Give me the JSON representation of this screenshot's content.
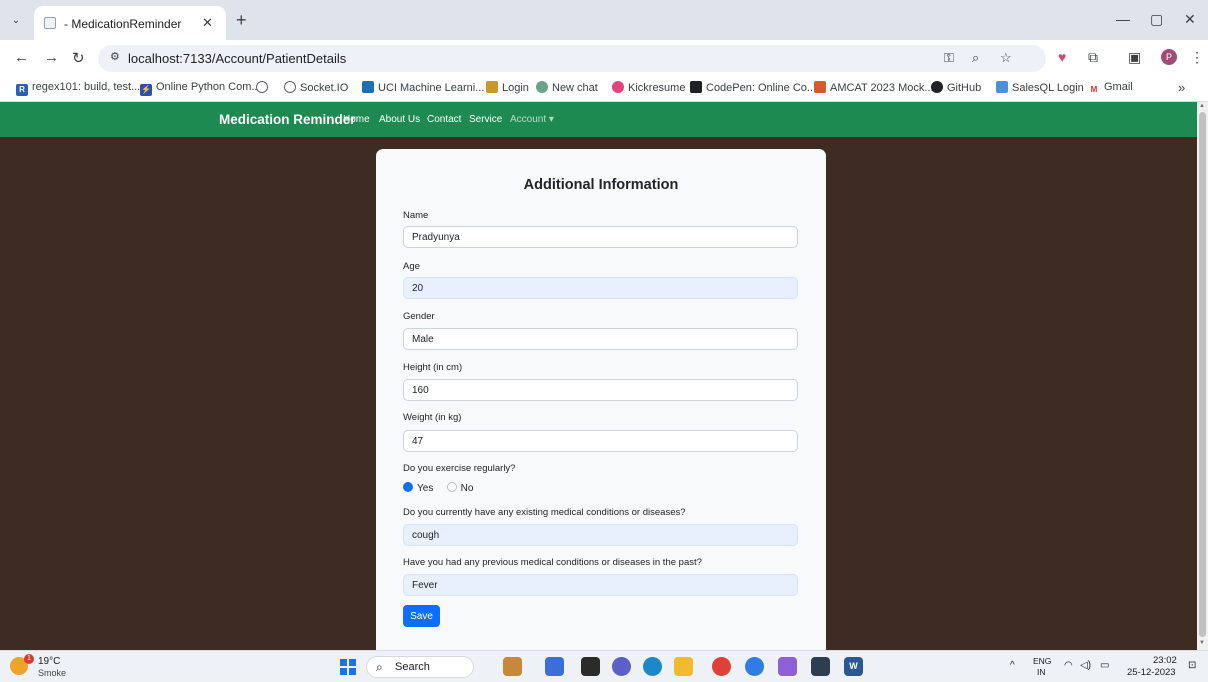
{
  "browser": {
    "tab": {
      "title": "- MedicationReminder"
    },
    "url": "localhost:7133/Account/PatientDetails",
    "bookmarks": [
      {
        "label": "regex101: build, test...",
        "icon": "regex101-icon",
        "color": "#2c5fb8",
        "glyph": "R"
      },
      {
        "label": "Online Python Com...",
        "icon": "python-compiler-icon",
        "color": "#2b4fb5",
        "glyph": "⚡"
      },
      {
        "label": "",
        "icon": "globe-icon",
        "color": "#5f6368",
        "glyph": ""
      },
      {
        "label": "Socket.IO",
        "icon": "socketio-icon",
        "color": "#5f6368",
        "glyph": ""
      },
      {
        "label": "UCI Machine Learni...",
        "icon": "uci-icon",
        "color": "#1f6fb2",
        "glyph": ""
      },
      {
        "label": "Login",
        "icon": "login-icon",
        "color": "#c89a2e",
        "glyph": ""
      },
      {
        "label": "New chat",
        "icon": "chatgpt-icon",
        "color": "#6aa38a",
        "glyph": ""
      },
      {
        "label": "Kickresume",
        "icon": "kickresume-icon",
        "color": "#e2447a",
        "glyph": ""
      },
      {
        "label": "CodePen: Online Co...",
        "icon": "codepen-icon",
        "color": "#202124",
        "glyph": ""
      },
      {
        "label": "AMCAT 2023 Mock...",
        "icon": "amcat-icon",
        "color": "#d45a2b",
        "glyph": ""
      },
      {
        "label": "GitHub",
        "icon": "github-icon",
        "color": "#202124",
        "glyph": ""
      },
      {
        "label": "SalesQL Login",
        "icon": "salesql-icon",
        "color": "#4a90d9",
        "glyph": ""
      },
      {
        "label": "Gmail",
        "icon": "gmail-icon",
        "color": "#d93025",
        "glyph": "M"
      }
    ],
    "profile_initial": "P"
  },
  "navbar": {
    "brand": "Medication Reminder",
    "links": [
      "Home",
      "About Us",
      "Contact",
      "Service"
    ],
    "account": "Account ▾"
  },
  "form": {
    "title": "Additional Information",
    "name_label": "Name",
    "name_value": "Pradyunya",
    "age_label": "Age",
    "age_value": "20",
    "gender_label": "Gender",
    "gender_value": "Male",
    "height_label": "Height (in cm)",
    "height_value": "160",
    "weight_label": "Weight (in kg)",
    "weight_value": "47",
    "exercise_label": "Do you exercise regularly?",
    "exercise_yes": "Yes",
    "exercise_no": "No",
    "exercise_selected": "Yes",
    "current_label": "Do you currently have any existing medical conditions or diseases?",
    "current_value": "cough",
    "past_label": "Have you had any previous medical conditions or diseases in the past?",
    "past_value": "Fever",
    "save_label": "Save"
  },
  "taskbar": {
    "weather_temp": "19°C",
    "weather_cond": "Smoke",
    "weather_badge": "1",
    "search": "Search",
    "lang_top": "ENG",
    "lang_bottom": "IN",
    "time": "23:02",
    "date": "25-12-2023"
  },
  "colors": {
    "navbar": "#1d8a52",
    "page_bg": "#3e2c22",
    "primary": "#0d6efd"
  }
}
